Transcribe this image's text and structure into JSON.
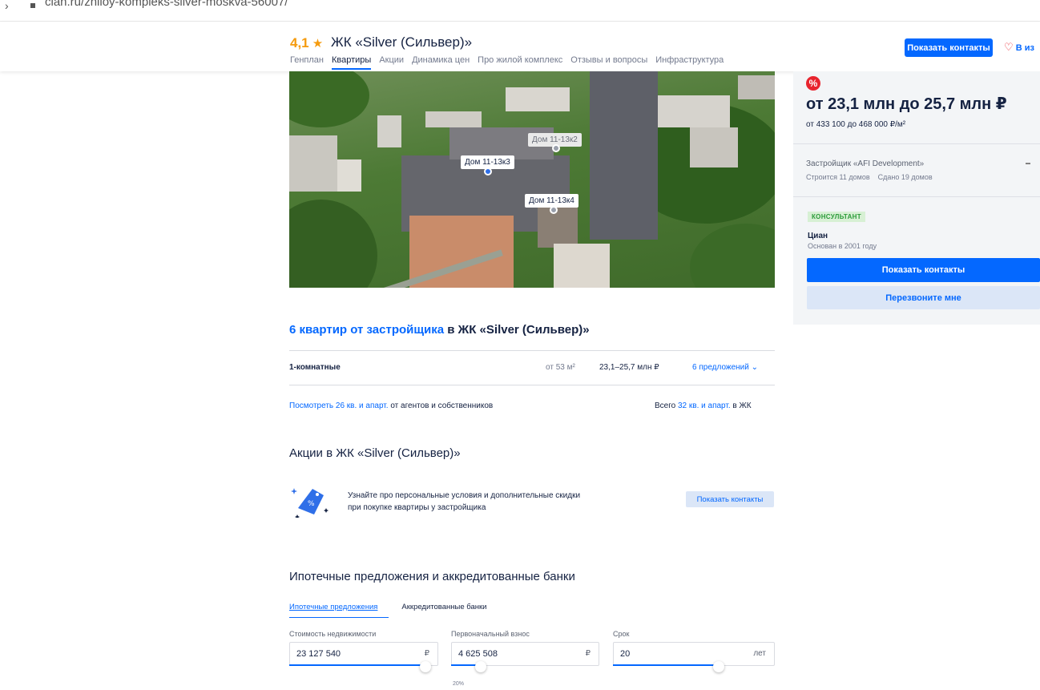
{
  "browser": {
    "url": "cian.ru/zhiloy-kompleks-silver-moskva-56007/"
  },
  "header": {
    "rating": "4,1",
    "title": "ЖК «Silver (Сильвер)»",
    "nav": [
      "Генплан",
      "Квартиры",
      "Акции",
      "Динамика цен",
      "Про жилой комплекс",
      "Отзывы и вопросы",
      "Инфраструктура"
    ],
    "active_nav": "Квартиры",
    "contacts_button": "Показать контакты",
    "favorite_label": "В из"
  },
  "gallery": {
    "pins": [
      {
        "label": "Дом 11-13к3",
        "color": "#2f6fe8"
      },
      {
        "label": "Дом 11-13к2",
        "color": "#9aa0ac"
      },
      {
        "label": "Дом 11-13к4",
        "color": "#9aa0ac"
      }
    ]
  },
  "sidebar": {
    "discount_badge": "%",
    "price_range": "от 23,1 млн до 25,7 млн ₽",
    "price_per_m2": "от 433 100 до 468 000 ₽/м²",
    "developer": "Застройщик «AFI Development»",
    "building": "Строится 11 домов",
    "delivered": "Сдано 19 домов",
    "consultant_tag": "КОНСУЛЬТАНТ",
    "consultant_name": "Циан",
    "consultant_since": "Основан в 2001 году",
    "show_contacts": "Показать контакты",
    "callback": "Перезвоните мне"
  },
  "flats": {
    "title_link": "6 квартир от застройщика",
    "title_rest": " в ЖК «Silver (Сильвер)»",
    "rows": [
      {
        "type": "1-комнатные",
        "area": "от 53 м²",
        "price": "23,1–25,7 млн ₽",
        "offers": "6 предложений"
      }
    ],
    "more_link": "Посмотреть 26 кв. и апарт.",
    "more_rest": " от агентов и собственников",
    "total_prefix": "Всего ",
    "total_link": "32 кв. и апарт.",
    "total_suffix": " в ЖК"
  },
  "promo": {
    "title": "Акции в ЖК «Silver (Сильвер)»",
    "text_line1": "Узнайте про персональные условия и дополнительные скидки",
    "text_line2": "при покупке квартиры у застройщика",
    "button": "Показать контакты"
  },
  "mortgage": {
    "title": "Ипотечные предложения и аккредитованные банки",
    "tabs": [
      "Ипотечные предложения",
      "Аккредитованные банки"
    ],
    "fields": [
      {
        "label": "Стоимость недвижимости",
        "value": "23 127 540",
        "unit": "₽"
      },
      {
        "label": "Первоначальный взнос",
        "value": "4 625 508",
        "unit": "₽"
      },
      {
        "label": "Срок",
        "value": "20",
        "unit": "лет"
      }
    ],
    "down_payment_percent": "20%"
  },
  "colors": {
    "accent": "#0468ff",
    "rating": "#f59b0e",
    "favorite": "#e8242e",
    "consultant": "#2b9b3a"
  }
}
